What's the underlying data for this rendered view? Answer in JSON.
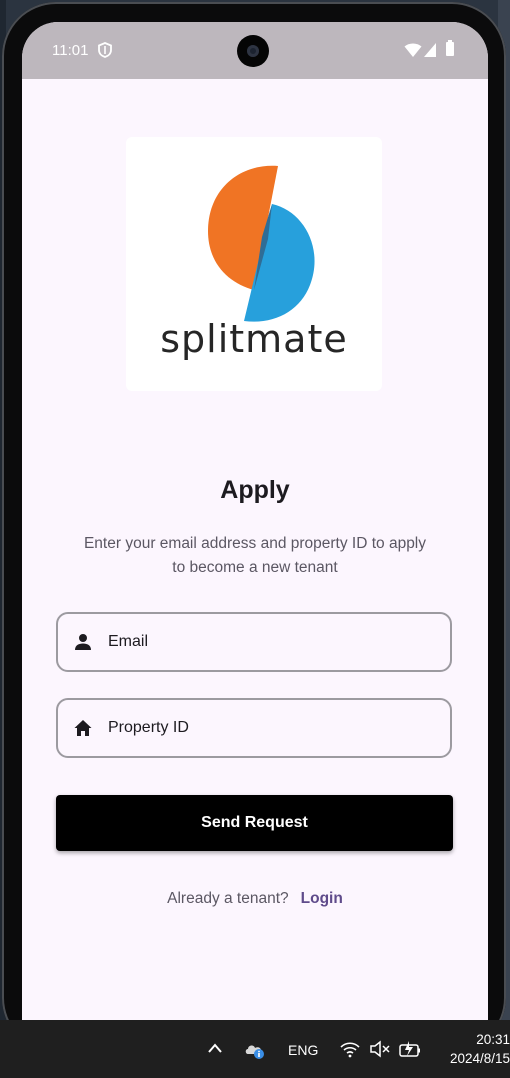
{
  "status_bar": {
    "time": "11:01"
  },
  "logo": {
    "wordmark": "splitmate",
    "colors": {
      "orange": "#f07424",
      "blue": "#27a0dc",
      "text": "#262626"
    }
  },
  "page": {
    "title": "Apply",
    "subtitle": "Enter your email address and property ID to apply to become a new tenant"
  },
  "form": {
    "email": {
      "placeholder": "Email",
      "value": "",
      "icon": "person-icon"
    },
    "property_id": {
      "placeholder": "Property ID",
      "value": "",
      "icon": "home-icon"
    },
    "submit_label": "Send Request"
  },
  "footer": {
    "question": "Already a tenant?",
    "login_label": "Login"
  },
  "taskbar": {
    "language": "ENG",
    "time": "20:31",
    "date": "2024/8/15"
  },
  "colors": {
    "background": "#fcf6fe",
    "button": "#000000",
    "link": "#5f4b8b",
    "status_bar": "#bdb7bd"
  }
}
